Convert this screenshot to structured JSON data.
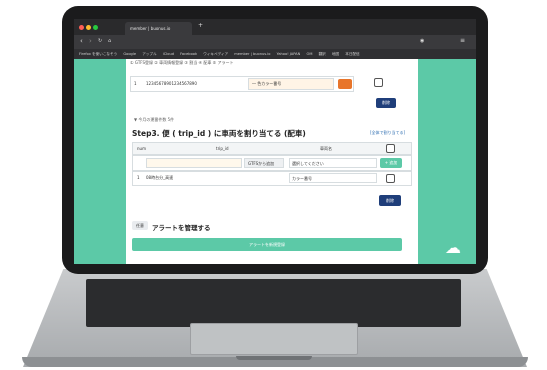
{
  "browser": {
    "tab_title": "member | buonus.io",
    "url": "gtfs.bus/member/",
    "bookmarks": [
      "Firefox を使いこなそう",
      "Google",
      "アップル",
      "iCloud",
      "Facebook",
      "ウィキペディア",
      "member | buonus.io",
      "Yahoo! JAPAN",
      "OM",
      "翻訳",
      "地図",
      "本日配信"
    ]
  },
  "page": {
    "breadcrumbs": "① GTFS登録  ② 車両情報登録  ③ 割当  ④ 配車  ⑤ アラート",
    "top_row": {
      "index": "1",
      "code": "12345678901234567890",
      "select_placeholder": "― 色カラー番号"
    },
    "save_button": "削除",
    "collapse_note": "▼ 今月の運番件数 5件",
    "step3": {
      "title": "Step3. 便 ( trip_id ) に車両を割り当てる (配車)",
      "link": "[全体で割り当てる]",
      "col_num": "num",
      "col_trip": "trip_id",
      "col_vehicle": "車両名",
      "gtfs_button": "GTFSから追加",
      "select_placeholder": "選択してください",
      "add_button": "+ 追加",
      "row": {
        "index": "1",
        "trip": "08時台分_高速",
        "vehicle": "カラー番号"
      },
      "delete_button": "削除"
    },
    "alert": {
      "badge": "任意",
      "title": "アラートを管理する",
      "button": "アラートを新規登録"
    }
  },
  "colors": {
    "accent": "#5cc9a7",
    "navy": "#1f3e7a"
  }
}
